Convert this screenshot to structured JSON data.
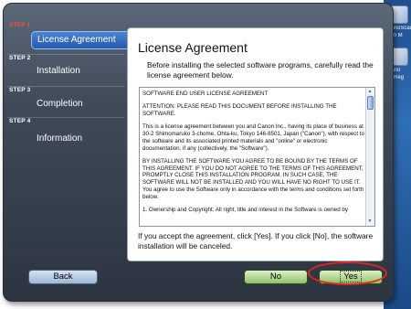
{
  "desktop": {
    "icons": [
      {
        "label": "CanoScan Lit",
        "sublabel": "een M"
      },
      {
        "label": "Cano",
        "sublabel": "er Reg"
      }
    ]
  },
  "sidebar": {
    "steps": [
      {
        "tag": "STEP 1",
        "label": "License Agreement",
        "active": true
      },
      {
        "tag": "STEP 2",
        "label": "Installation",
        "active": false
      },
      {
        "tag": "STEP 3",
        "label": "Completion",
        "active": false
      },
      {
        "tag": "STEP 4",
        "label": "Information",
        "active": false
      }
    ]
  },
  "panel": {
    "title": "License Agreement",
    "intro": "Before installing the selected software programs, carefully read the license agreement below.",
    "eula": [
      "SOFTWARE END USER LICENSE AGREEMENT",
      "ATTENTION: PLEASE READ THIS DOCUMENT BEFORE INSTALLING THE SOFTWARE.",
      "This is a license agreement between you and Canon Inc., having its place of business at 30-2 Shimomaruko 3-chome, Ohta-ku, Tokyo 146-8501, Japan (\"Canon\"), with respect to the software and its associated printed materials and \"online\" or electronic documentation, if any (collectively, the \"Software\").",
      "BY INSTALLING THE SOFTWARE YOU AGREE TO BE BOUND BY THE TERMS OF THIS AGREEMENT.  IF YOU DO NOT AGREE TO THE TERMS OF THIS AGREEMENT, PROMPTLY CLOSE THIS INSTALLATION PROGRAM.  IN SUCH CASE, THE SOFTWARE WILL NOT BE INSTALLED AND YOU WILL HAVE NO RIGHT TO USE IT.",
      "You agree to use the Software only in accordance with the terms and conditions set forth below.",
      "1. Ownership and Copyright:  All right, title and interest in the Software is owned by"
    ],
    "footer": "If you accept the agreement, click [Yes]. If you click [No], the software installation will be canceled."
  },
  "buttons": {
    "back": "Back",
    "no": "No",
    "yes": "Yes"
  }
}
